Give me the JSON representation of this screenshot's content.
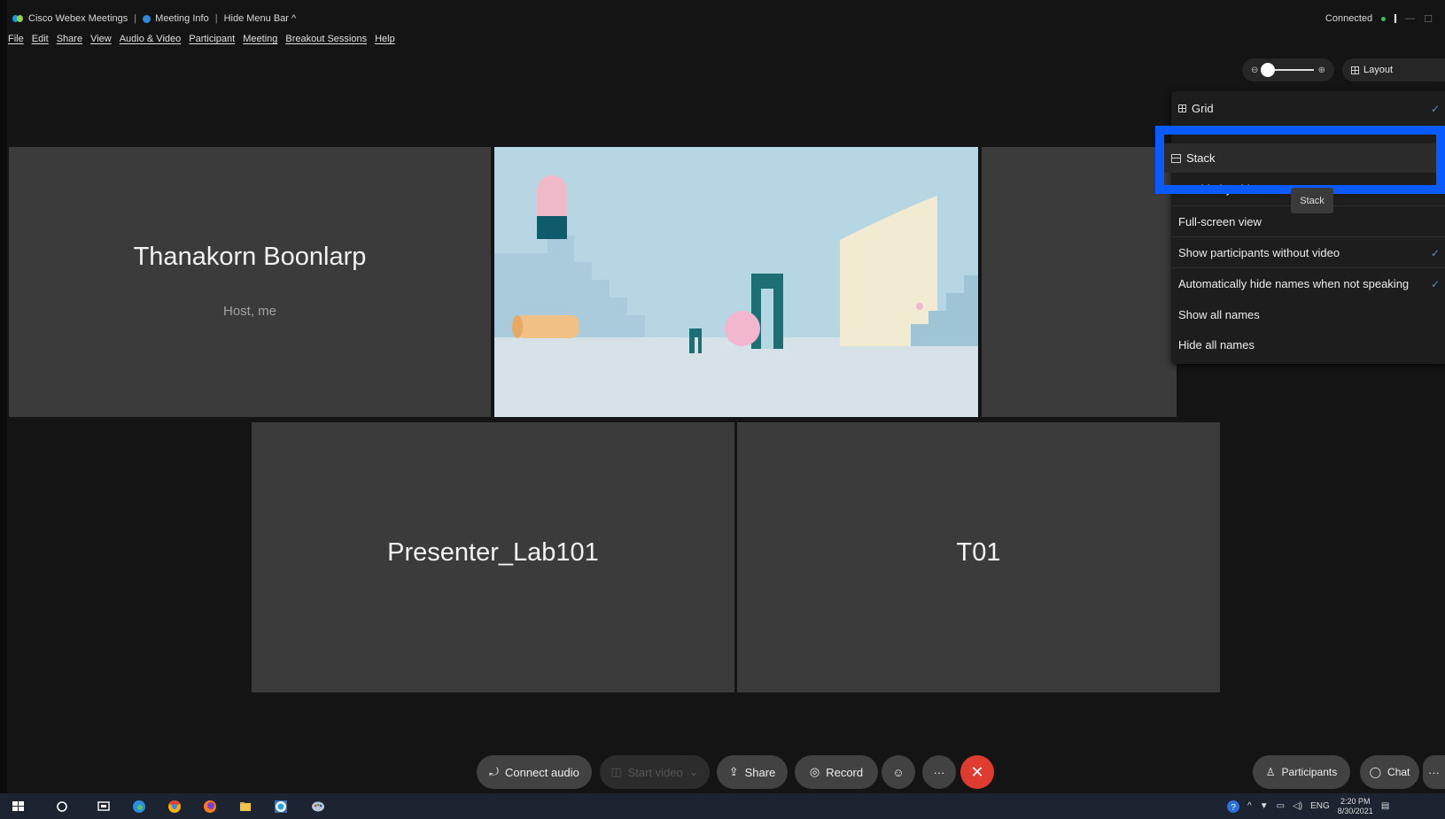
{
  "titlebar": {
    "app_name": "Cisco Webex Meetings",
    "sep1": "|",
    "meeting_info": "Meeting Info",
    "sep2": "|",
    "hide_menu_bar": "Hide Menu Bar",
    "hide_menu_bar_chevron": "^",
    "status": "Connected",
    "minimize": "—",
    "restore": "☐"
  },
  "menubar": [
    "File",
    "Edit",
    "Share",
    "View",
    "Audio & Video",
    "Participant",
    "Meeting",
    "Breakout Sessions",
    "Help"
  ],
  "zoom": {
    "minus_label": "⊖",
    "plus_label": "⊕",
    "level": 0
  },
  "layout_button": {
    "label": "Layout"
  },
  "layout_menu": {
    "items": [
      {
        "label": "Grid",
        "icon": "grid-icon",
        "checked": true
      },
      {
        "label": "Stack",
        "icon": "stack-icon",
        "checked": false
      },
      {
        "label": "Side by side",
        "icon": "side-by-side-icon",
        "checked": false
      },
      {
        "label": "Full-screen view",
        "checked": false
      },
      {
        "label": "Show participants without video",
        "checked": true
      },
      {
        "label": "Automatically hide names when not speaking",
        "checked": true
      },
      {
        "label": "Show all names",
        "checked": false
      },
      {
        "label": "Hide all names",
        "checked": false
      }
    ],
    "check_glyph": "✓",
    "tooltip": "Stack",
    "highlight_color": "#0a5bff"
  },
  "participants": [
    {
      "name": "Thanakorn Boonlarp",
      "role": "Host, me"
    },
    {
      "name": "Presenter_Lab101"
    },
    {
      "name": "T01"
    }
  ],
  "controls": {
    "connect_audio": "Connect audio",
    "start_video": "Start video",
    "share": "Share",
    "record": "Record",
    "reactions_icon": "smiley-icon",
    "more": "···",
    "end": "✕",
    "participants": "Participants",
    "chat": "Chat",
    "panel_more": "···"
  },
  "taskbar": {
    "lang": "ENG",
    "time": "2:20 PM",
    "date": "8/30/2021"
  },
  "colors": {
    "accent": "#0a5bff",
    "end_call": "#e03b2f",
    "connected": "#37c35a",
    "tile": "#3b3b3b"
  }
}
